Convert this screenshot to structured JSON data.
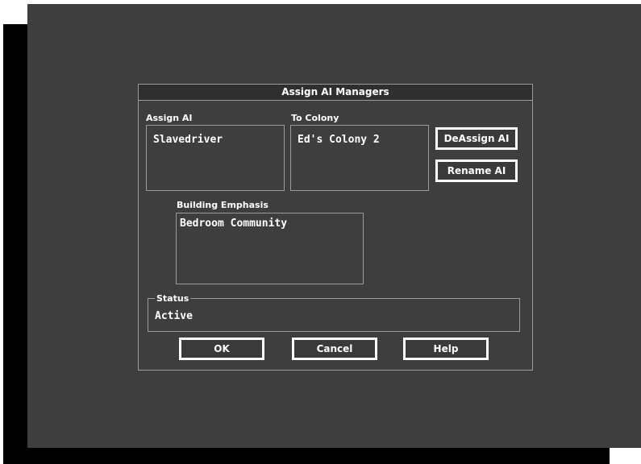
{
  "dialog": {
    "title": "Assign AI Managers",
    "assign_ai": {
      "label": "Assign AI",
      "value": "Slavedriver"
    },
    "to_colony": {
      "label": "To Colony",
      "value": "Ed's Colony 2"
    },
    "buttons": {
      "deassign": "DeAssign AI",
      "rename": "Rename AI",
      "ok": "OK",
      "cancel": "Cancel",
      "help": "Help"
    },
    "building_emphasis": {
      "label": "Building Emphasis",
      "value": "Bedroom Community"
    },
    "status": {
      "label": "Status",
      "value": "Active"
    }
  }
}
